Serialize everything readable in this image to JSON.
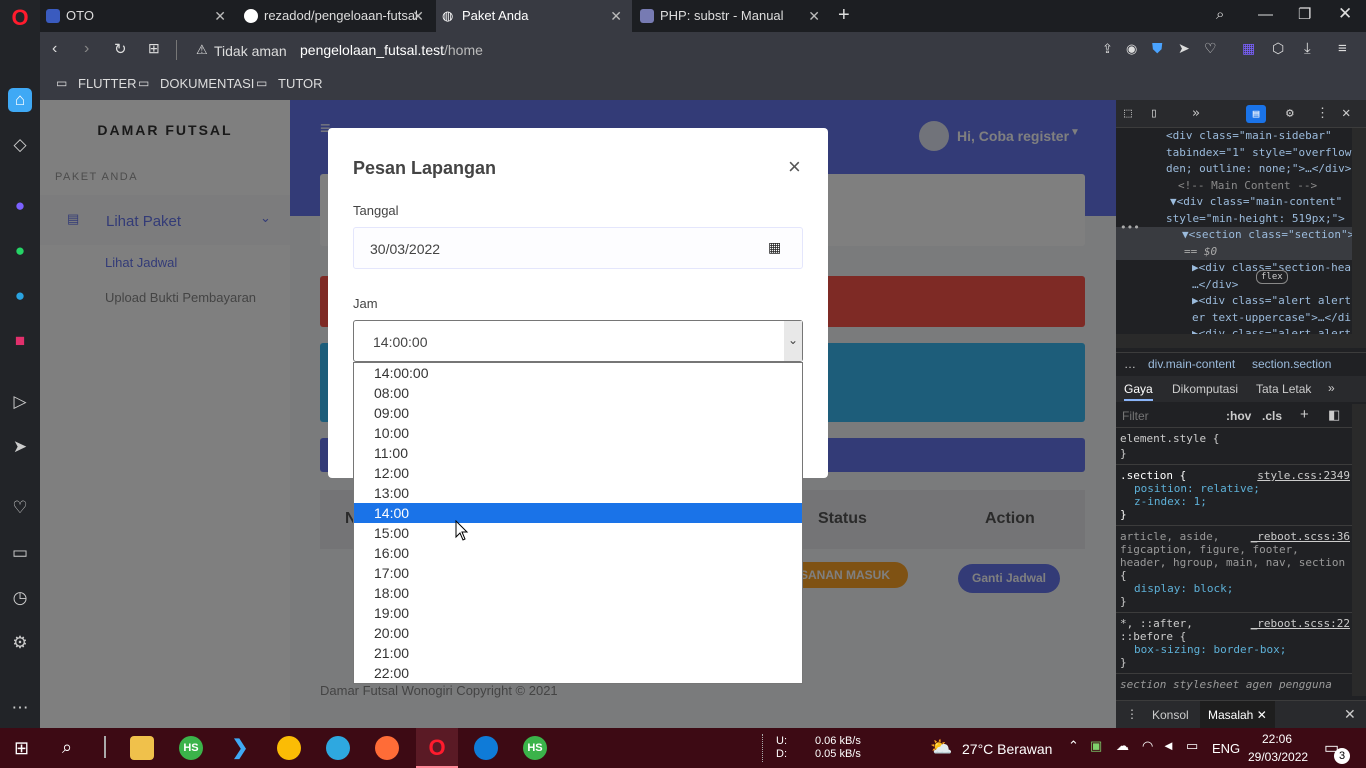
{
  "browser": {
    "tabs": [
      {
        "label": "OTO",
        "active": false
      },
      {
        "label": "rezadod/pengeloaan-futsal",
        "active": false
      },
      {
        "label": "Paket Anda",
        "active": true
      },
      {
        "label": "PHP: substr - Manual",
        "active": false
      }
    ],
    "security_label": "Tidak aman",
    "url_host": "pengelolaan_futsal.test",
    "url_path": "/home",
    "bookmarks": [
      "FLUTTER",
      "DOKUMENTASI",
      "TUTOR"
    ]
  },
  "sidebar": {
    "brand": "DAMAR FUTSAL",
    "section_label": "PAKET ANDA",
    "menu_label": "Lihat Paket",
    "sub_items": [
      "Lihat Jadwal",
      "Upload Bukti Pembayaran"
    ]
  },
  "header": {
    "greeting": "Hi, Coba register"
  },
  "table": {
    "headers": [
      "N",
      "Status",
      "Action"
    ],
    "status_badge": "SANAN MASUK",
    "action_button": "Ganti Jadwal"
  },
  "footer": {
    "text": "Damar Futsal Wonogiri Copyright © 2021"
  },
  "modal": {
    "title": "Pesan Lapangan",
    "close": "×",
    "date_label": "Tanggal",
    "date_value": "30/03/2022",
    "time_label": "Jam",
    "time_value": "14:00:00"
  },
  "dropdown": {
    "options": [
      "14:00:00",
      "08:00",
      "09:00",
      "10:00",
      "11:00",
      "12:00",
      "13:00",
      "14:00",
      "15:00",
      "16:00",
      "17:00",
      "18:00",
      "19:00",
      "20:00",
      "21:00",
      "22:00"
    ],
    "highlighted": "14:00"
  },
  "devtools": {
    "elements_lines": [
      "<div class=\"main-sidebar\"",
      "tabindex=\"1\" style=\"overflow",
      "den; outline: none;\">…</div>",
      "<!-- Main Content -->",
      "▼<div class=\"main-content\"",
      "style=\"min-height: 519px;\">",
      "▼<section class=\"section\">",
      "== $0",
      "▶<div class=\"section-hea",
      "…</div>",
      "▶<div class=\"alert alert-",
      "er text-uppercase\">…</di",
      "▶<div class=\"alert alert-"
    ],
    "flex_badge": "flex",
    "breadcrumb": [
      "div.main-content",
      "section.section"
    ],
    "style_tabs": [
      "Gaya",
      "Dikomputasi",
      "Tata Letak"
    ],
    "filter_placeholder": "Filter",
    "hov": ":hov",
    "cls": ".cls",
    "rules": [
      {
        "selector": "element.style {",
        "source": "",
        "props": []
      },
      {
        "selector": ".section {",
        "source": "style.css:2349",
        "props": [
          "position: relative;",
          "z-index: 1;"
        ]
      },
      {
        "selector": "article, aside,",
        "source": "_reboot.scss:36",
        "props": []
      },
      {
        "selector": "*, ::after,",
        "source": "_reboot.scss:22",
        "props": []
      }
    ],
    "rule2_extra": [
      "figcaption, figure, footer,",
      "header, hgroup, main, nav, section",
      "{",
      "display: block;"
    ],
    "rule3_extra": [
      "::before {",
      "box-sizing: border-box;"
    ],
    "last_line": "section  stylesheet agen pengguna",
    "drawer_tabs": [
      "Konsol",
      "Masalah"
    ]
  },
  "taskbar": {
    "net_up_label": "U:",
    "net_up": "0.06 kB/s",
    "net_down_label": "D:",
    "net_down": "0.05 kB/s",
    "weather": "27°C Berawan",
    "lang": "ENG",
    "time": "22:06",
    "date": "29/03/2022",
    "notif_count": "3"
  },
  "colors": {
    "primary": "#6777ef",
    "danger": "#fc544b",
    "info": "#3abaf4",
    "warning": "#ffa426",
    "taskbar": "#3d0a14",
    "highlight": "#1a73e8"
  }
}
